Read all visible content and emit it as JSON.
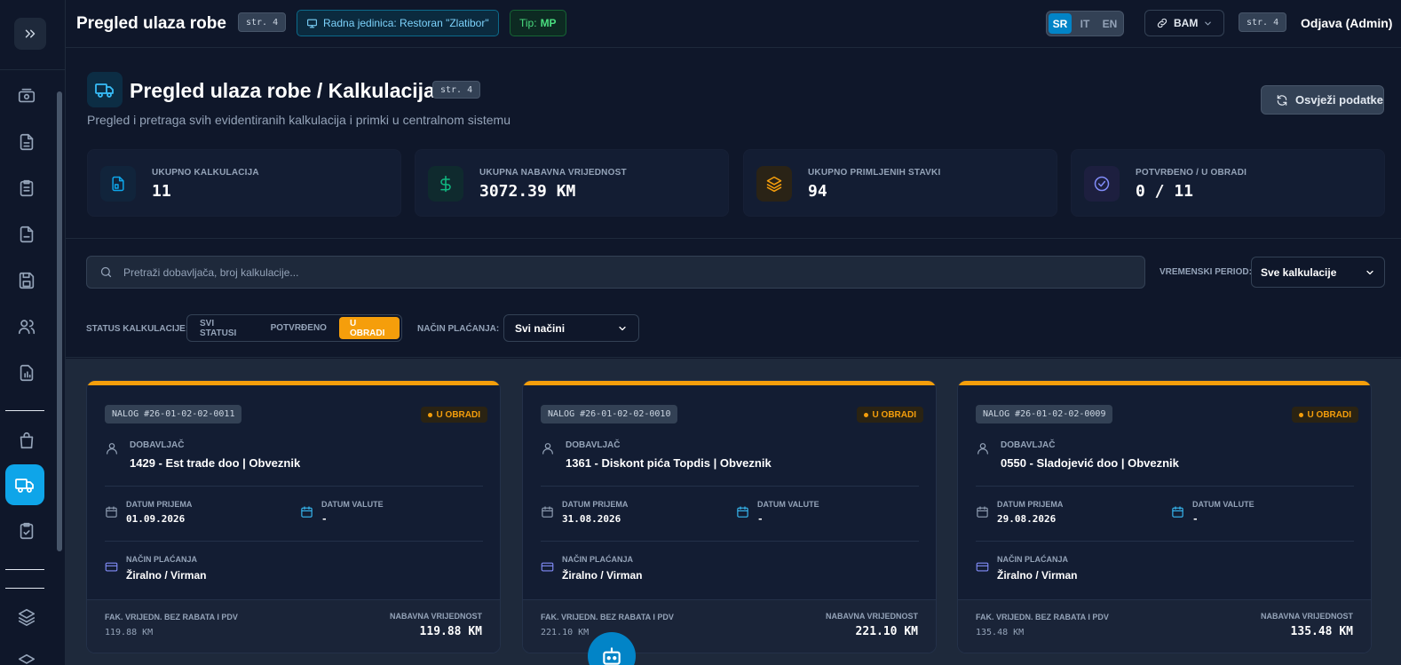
{
  "topbar": {
    "title": "Pregled ulaza robe",
    "page_badge": "str. 4",
    "unit_label": "Radna jedinica: Restoran \"Zlatibor\"",
    "tip_label": "Tip:",
    "tip_value": "MP",
    "languages": [
      "SR",
      "IT",
      "EN"
    ],
    "active_language": "SR",
    "currency": "BAM",
    "page_badge_right": "str. 4",
    "logout": "Odjava (Admin)"
  },
  "header": {
    "title": "Pregled ulaza robe / Kalkulacija",
    "page_badge": "str. 4",
    "subtitle": "Pregled i pretraga svih evidentiranih kalkulacija i primki u centralnom sistemu",
    "refresh_label": "Osvježi podatke"
  },
  "stats": [
    {
      "label": "UKUPNO KALKULACIJA",
      "value": "11",
      "icon": "document-icon",
      "color": "#0ea5e9"
    },
    {
      "label": "UKUPNA NABAVNA VRIJEDNOST",
      "value": "3072.39 KM",
      "icon": "dollar-icon",
      "color": "#10b981"
    },
    {
      "label": "UKUPNO PRIMLJENIH STAVKI",
      "value": "94",
      "icon": "layers-icon",
      "color": "#f59e0b"
    },
    {
      "label": "POTVRĐENO / U OBRADI",
      "value": "0 / 11",
      "icon": "check-circle-icon",
      "color": "#818cf8"
    }
  ],
  "filters": {
    "search_placeholder": "Pretraži dobavljača, broj kalkulacije...",
    "period_label": "VREMENSKI PERIOD:",
    "period_value": "Sve kalkulacije",
    "status_label": "STATUS KALKULACIJE:",
    "status_options": [
      "SVI STATUSI",
      "POTVRĐENO",
      "U OBRADI"
    ],
    "status_active": "U OBRADI",
    "payment_label": "NAČIN PLAĆANJA:",
    "payment_value": "Svi načini"
  },
  "card_labels": {
    "supplier": "DOBAVLJAČ",
    "received": "DATUM PRIJEMA",
    "due": "DATUM VALUTE",
    "payment": "NAČIN PLAĆANJA",
    "invoice_value": "FAK. VRIJEDN. BEZ RABATA I PDV",
    "purchase_value": "NABAVNA VRIJEDNOST"
  },
  "cards": [
    {
      "nalog": "NALOG #26-01-02-02-0011",
      "status": "U OBRADI",
      "supplier": "1429 - Est trade doo | Obveznik",
      "received": "01.09.2026",
      "due": "-",
      "payment": "Žiralno / Virman",
      "invoice_value": "119.88 KM",
      "purchase_value": "119.88 KM"
    },
    {
      "nalog": "NALOG #26-01-02-02-0010",
      "status": "U OBRADI",
      "supplier": "1361 - Diskont pića Topdis | Obveznik",
      "received": "31.08.2026",
      "due": "-",
      "payment": "Žiralno / Virman",
      "invoice_value": "221.10 KM",
      "purchase_value": "221.10 KM"
    },
    {
      "nalog": "NALOG #26-01-02-02-0009",
      "status": "U OBRADI",
      "supplier": "0550 - Sladojević doo | Obveznik",
      "received": "29.08.2026",
      "due": "-",
      "payment": "Žiralno / Virman",
      "invoice_value": "135.48 KM",
      "purchase_value": "135.48 KM"
    }
  ],
  "colors": {
    "accent": "#0ea5e9",
    "status_in_progress": "#f59e0b",
    "success": "#4ade80"
  }
}
